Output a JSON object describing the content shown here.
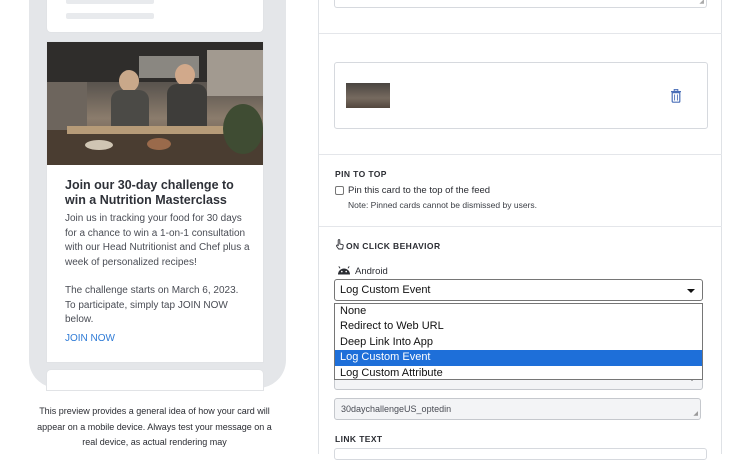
{
  "preview": {
    "card": {
      "title": "Join our 30-day challenge to win a Nutrition Masterclass",
      "body_paragraph_1": "Join us in tracking your food for 30 days for a chance to win a 1-on-1 consultation with our Head Nutritionist and Chef plus a week of personalized recipes!",
      "body_paragraph_2": "The challenge starts on March 6, 2023. To participate, simply tap JOIN NOW below.",
      "cta_label": "JOIN NOW"
    },
    "note": "This preview provides a general idea of how your card will appear on a mobile device. Always test your message on a real device, as actual rendering may"
  },
  "form": {
    "pin_to_top": {
      "section_title": "PIN TO TOP",
      "checkbox_label": "Pin this card to the top of the feed",
      "checked": false,
      "note": "Note: Pinned cards cannot be dismissed by users."
    },
    "on_click_behavior": {
      "section_title": "ON CLICK BEHAVIOR",
      "platform_label": "Android",
      "selected_value": "Log Custom Event",
      "options": [
        "None",
        "Redirect to Web URL",
        "Deep Link Into App",
        "Log Custom Event",
        "Log Custom Attribute"
      ],
      "highlighted_index": 3,
      "hidden_select_value": "Log Custom Event",
      "event_name_value": "30daychallengeUS_optedin"
    },
    "link_text": {
      "section_title": "LINK TEXT"
    }
  },
  "icons": {
    "media_delete": "trash-icon",
    "click_behavior": "pointer-click-icon",
    "platform": "android-icon",
    "highlight_color": "#1e6fd9",
    "cta_color": "#2f7bd6"
  }
}
